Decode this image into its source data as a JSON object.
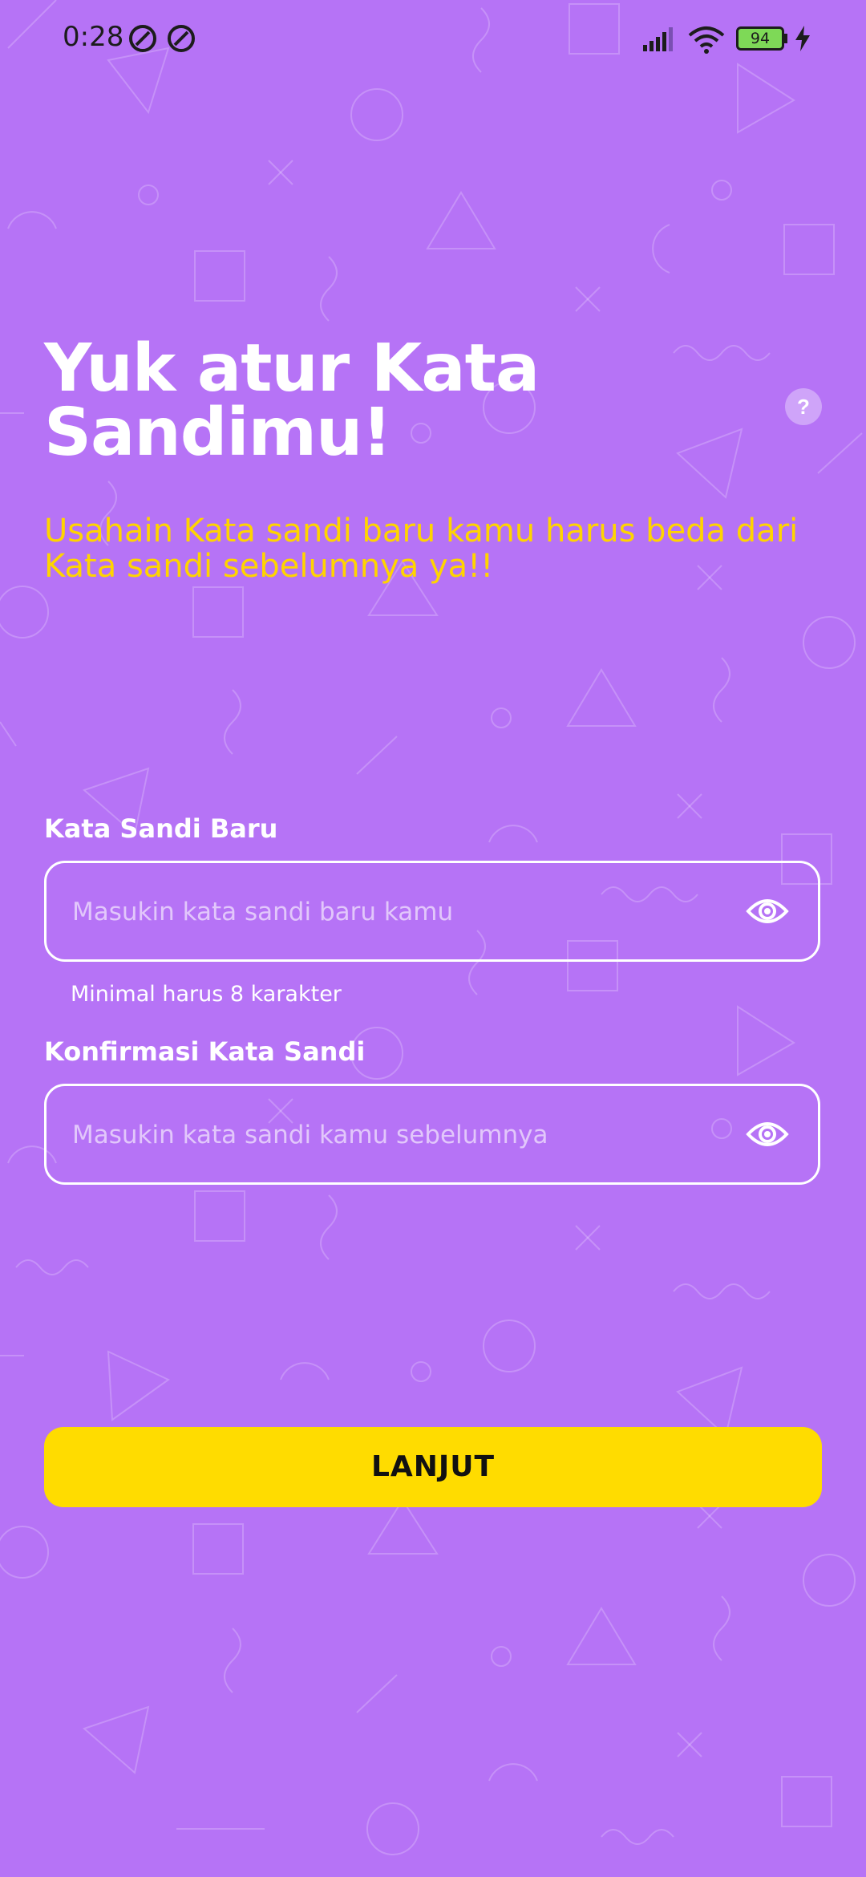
{
  "status_bar": {
    "time": "0:28",
    "battery_level": "94",
    "icons": [
      "notification-icon",
      "notification-icon",
      "signal-icon",
      "wifi-icon",
      "battery-icon",
      "charging-icon"
    ]
  },
  "header": {
    "title": "Yuk atur Kata Sandimu!",
    "help_label": "?",
    "subtitle": "Usahain Kata sandi baru kamu harus beda dari Kata sandi sebelumnya ya!!"
  },
  "form": {
    "new_password": {
      "label": "Kata Sandi Baru",
      "placeholder": "Masukin kata sandi baru kamu",
      "value": "",
      "helper": "Minimal harus 8 karakter",
      "icon": "eye-icon"
    },
    "confirm_password": {
      "label": "Konfirmasi Kata Sandi",
      "placeholder": "Masukin kata sandi kamu sebelumnya",
      "value": "",
      "icon": "eye-icon"
    }
  },
  "actions": {
    "submit_label": "LANJUT"
  },
  "colors": {
    "background": "#b673f6",
    "accent": "#ffdc00",
    "subtitle": "#ffd400",
    "text": "#ffffff"
  }
}
